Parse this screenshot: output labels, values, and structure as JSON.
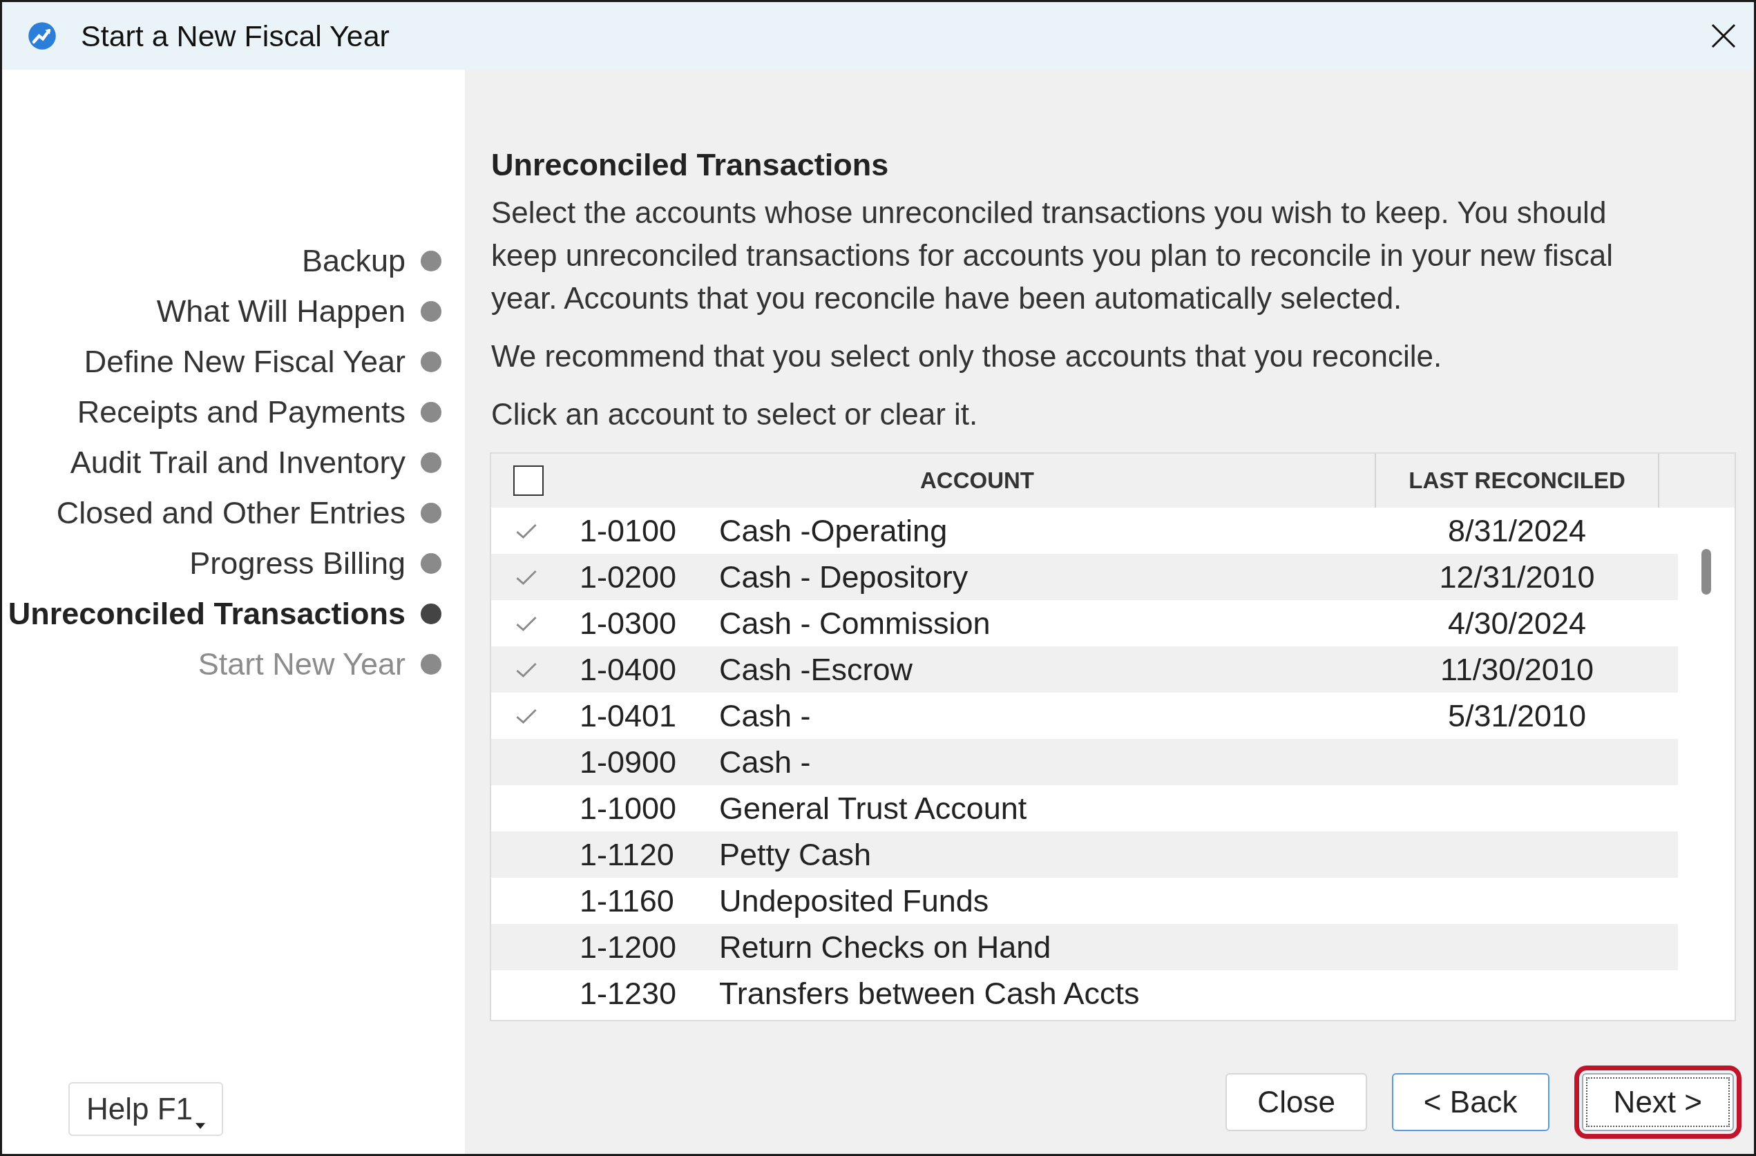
{
  "window": {
    "title": "Start a New Fiscal Year"
  },
  "steps": [
    {
      "label": "Backup",
      "selected": false,
      "disabled": false
    },
    {
      "label": "What Will Happen",
      "selected": false,
      "disabled": false
    },
    {
      "label": "Define New Fiscal Year",
      "selected": false,
      "disabled": false
    },
    {
      "label": "Receipts and Payments",
      "selected": false,
      "disabled": false
    },
    {
      "label": "Audit Trail and Inventory",
      "selected": false,
      "disabled": false
    },
    {
      "label": "Closed and Other Entries",
      "selected": false,
      "disabled": false
    },
    {
      "label": "Progress Billing",
      "selected": false,
      "disabled": false
    },
    {
      "label": "Unreconciled Transactions",
      "selected": true,
      "disabled": false
    },
    {
      "label": "Start New Year",
      "selected": false,
      "disabled": true
    }
  ],
  "heading": "Unreconciled Transactions",
  "paragraphs": [
    "Select the accounts whose unreconciled transactions you wish to keep. You should keep unreconciled transactions for accounts you plan to reconcile in your new fiscal year. Accounts that you reconcile have been automatically selected.",
    "We recommend that you select only those accounts that you reconcile.",
    "Click an account to select or clear it."
  ],
  "table": {
    "select_all_checked": false,
    "columns": [
      "ACCOUNT",
      "LAST RECONCILED"
    ],
    "rows": [
      {
        "number": "1-0100",
        "name": "Cash -Operating",
        "last_reconciled": "8/31/2024",
        "checked": true
      },
      {
        "number": "1-0200",
        "name": "Cash - Depository",
        "last_reconciled": "12/31/2010",
        "checked": true
      },
      {
        "number": "1-0300",
        "name": "Cash - Commission",
        "last_reconciled": "4/30/2024",
        "checked": true
      },
      {
        "number": "1-0400",
        "name": "Cash -Escrow",
        "last_reconciled": "11/30/2010",
        "checked": true
      },
      {
        "number": "1-0401",
        "name": "Cash -",
        "last_reconciled": "5/31/2010",
        "checked": true
      },
      {
        "number": "1-0900",
        "name": "Cash -",
        "checked": false
      },
      {
        "number": "1-1000",
        "name": "General Trust Account",
        "checked": false
      },
      {
        "number": "1-1120",
        "name": "Petty Cash",
        "checked": false
      },
      {
        "number": "1-1160",
        "name": "Undeposited Funds",
        "checked": false
      },
      {
        "number": "1-1200",
        "name": "Return Checks on Hand",
        "checked": false
      },
      {
        "number": "1-1230",
        "name": "Transfers between Cash Accts",
        "checked": false
      }
    ]
  },
  "help_button": "Help F1",
  "buttons": [
    {
      "label": "Close",
      "kind": "plain"
    },
    {
      "label": "< Back",
      "kind": "default"
    },
    {
      "label": "Next >",
      "kind": "focused",
      "highlighted": true
    }
  ]
}
